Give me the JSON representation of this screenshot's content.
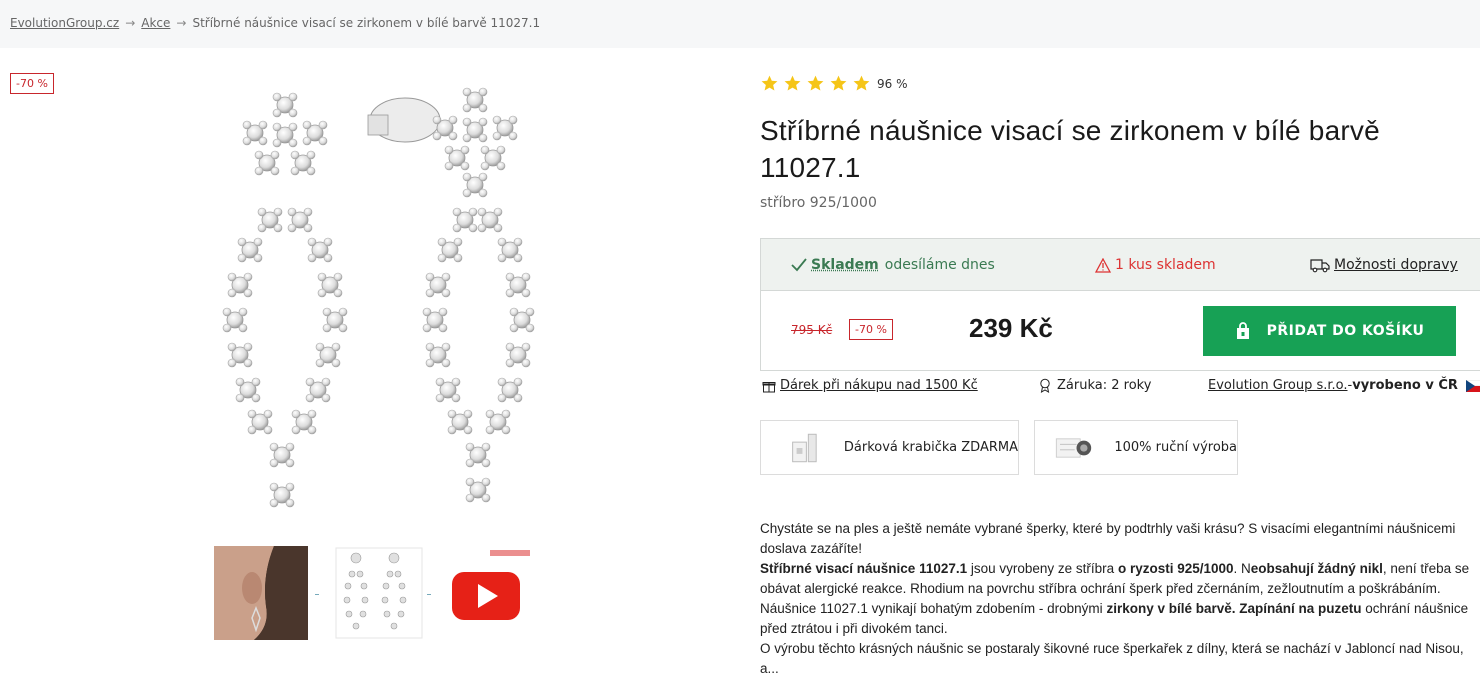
{
  "breadcrumb": {
    "items": [
      "EvolutionGroup.cz",
      "Akce"
    ],
    "separator": "→",
    "current": "Stříbrné náušnice visací se zirkonem v bílé barvě 11027.1"
  },
  "image_badge": "-70 %",
  "rating": {
    "stars": 5,
    "max": 5,
    "text": "96 %",
    "color": "#f5c518"
  },
  "product": {
    "title": "Stříbrné náušnice visací se zirkonem v bílé barvě 11027.1",
    "material": "stříbro 925/1000"
  },
  "stock": {
    "status_label": "Skladem",
    "status_note": "odesíláme dnes",
    "warning": "1 kus skladem",
    "shipping_link": "Možnosti dopravy"
  },
  "pricing": {
    "old_price": "795 Kč",
    "discount": "-70 %",
    "price": "239 Kč",
    "cart_button": "PŘIDAT DO KOŠÍKU",
    "accent": "#17a155"
  },
  "perks": {
    "gift": "Dárek při nákupu nad 1500 Kč",
    "warranty": "Záruka: 2 roky",
    "maker_link": "Evolution Group s.r.o.",
    "maker_sep": " - ",
    "maker_note": "vyrobeno v ČR"
  },
  "features": [
    {
      "label": "Dárková krabička ZDARMA",
      "icon": "gift-box-icon"
    },
    {
      "label": "100% ruční výroba",
      "icon": "handmade-icon"
    }
  ],
  "description": {
    "p1": "Chystáte se na ples a ještě nemáte vybrané šperky, které by podtrhly vaši krásu? S visacími elegantními náušnicemi doslava zazáříte!",
    "p2_b1": "Stříbrné visací náušnice 11027.1",
    "p2_t1": " jsou vyrobeny ze stříbra ",
    "p2_b2": "o ryzosti 925/1000",
    "p2_t2": ". N",
    "p2_b3": "eobsahují žádný nikl",
    "p2_t3": ", není třeba se obávat alergické reakce. Rhodium na povrchu stříbra ochrání šperk před zčernáním, zežloutnutím a poškrábáním.",
    "p3_t1": "Náušnice 11027.1 vynikají bohatým zdobením - drobnými ",
    "p3_b1": "zirkony v bílé barvě.",
    "p3_t2": " ",
    "p3_b2": "Zapínání na puzetu",
    "p3_t3": " ochrání náušnice před ztrátou i při divokém tanci.",
    "p4": "O výrobu těchto krásných náušnic se postaraly šikovné ruce šperkařek z dílny, která se nachází v Jabloncí nad Nisou, a..."
  }
}
